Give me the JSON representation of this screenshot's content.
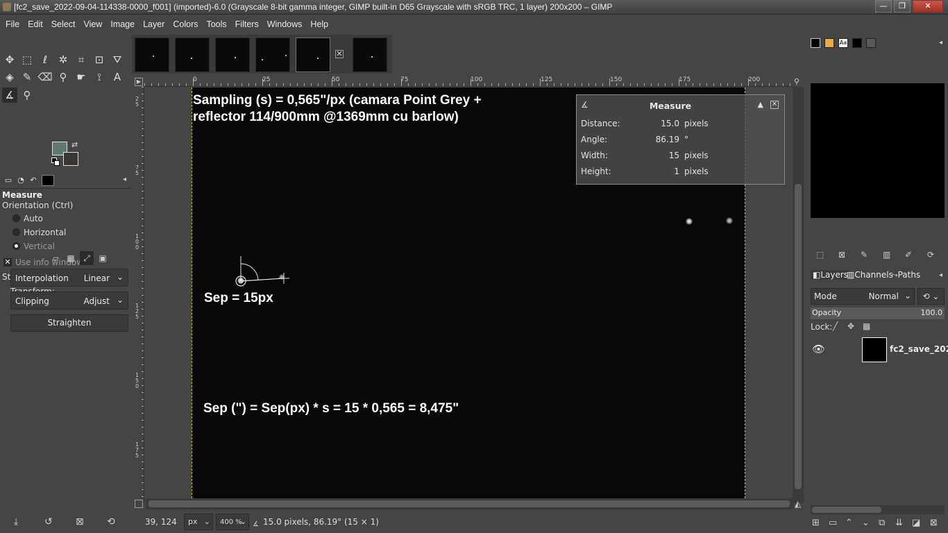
{
  "window": {
    "title": "[fc2_save_2022-09-04-114338-0000_f001] (imported)-6.0 (Grayscale 8-bit gamma integer, GIMP built-in D65 Grayscale with sRGB TRC, 1 layer) 200x200 – GIMP",
    "minimize_label": "—",
    "maximize_label": "❐",
    "close_label": "✕"
  },
  "menubar": [
    "File",
    "Edit",
    "Select",
    "View",
    "Image",
    "Layer",
    "Colors",
    "Tools",
    "Filters",
    "Windows",
    "Help"
  ],
  "colors": {
    "foreground": "#617a6f",
    "background": "#3a3633",
    "guide": "#c8c200"
  },
  "tool_options": {
    "title": "Measure",
    "orientation_label": "Orientation  (Ctrl)",
    "orientation_options": [
      "Auto",
      "Horizontal",
      "Vertical"
    ],
    "orientation_selected": "Vertical",
    "use_info_window": "Use info window",
    "use_info_window_checked": true,
    "straighten_heading": "Straighten",
    "transform_label": "Transform:",
    "interpolation_label": "Interpolation",
    "interpolation_value": "Linear",
    "clipping_label": "Clipping",
    "clipping_value": "Adjust",
    "straighten_button": "Straighten"
  },
  "rulers": {
    "h_labels": [
      "0",
      "25",
      "50",
      "75",
      "100",
      "125",
      "150",
      "175",
      "200"
    ],
    "v_labels": [
      "25",
      "75",
      "100",
      "125",
      "150",
      "175"
    ]
  },
  "canvas": {
    "annotation_1_line1": "Sampling (s) = 0,565\"/px (camara Point Grey +",
    "annotation_1_line2": "reflector 114/900mm @1369mm cu barlow)",
    "annotation_2": "Sep = 15px",
    "annotation_3": "Sep (\") = Sep(px) * s = 15 * 0,565 = 8,475\""
  },
  "measure": {
    "title": "Measure",
    "rows": [
      {
        "label": "Distance:",
        "value": "15.0",
        "unit": "pixels"
      },
      {
        "label": "Angle:",
        "value": "86.19",
        "unit": "°"
      },
      {
        "label": "Width:",
        "value": "15",
        "unit": "pixels"
      },
      {
        "label": "Height:",
        "value": "1",
        "unit": "pixels"
      }
    ]
  },
  "statusbar": {
    "coords": "39, 124",
    "unit": "px",
    "zoom": "400 %",
    "message": "15.0 pixels, 86.19° (15 × 1)"
  },
  "layers_panel": {
    "tabs": [
      "Layers",
      "Channels",
      "Paths"
    ],
    "mode_label": "Mode",
    "mode_value": "Normal",
    "opacity_label": "Opacity",
    "opacity_value": "100.0",
    "lock_label": "Lock:",
    "layer_name": "fc2_save_202"
  }
}
